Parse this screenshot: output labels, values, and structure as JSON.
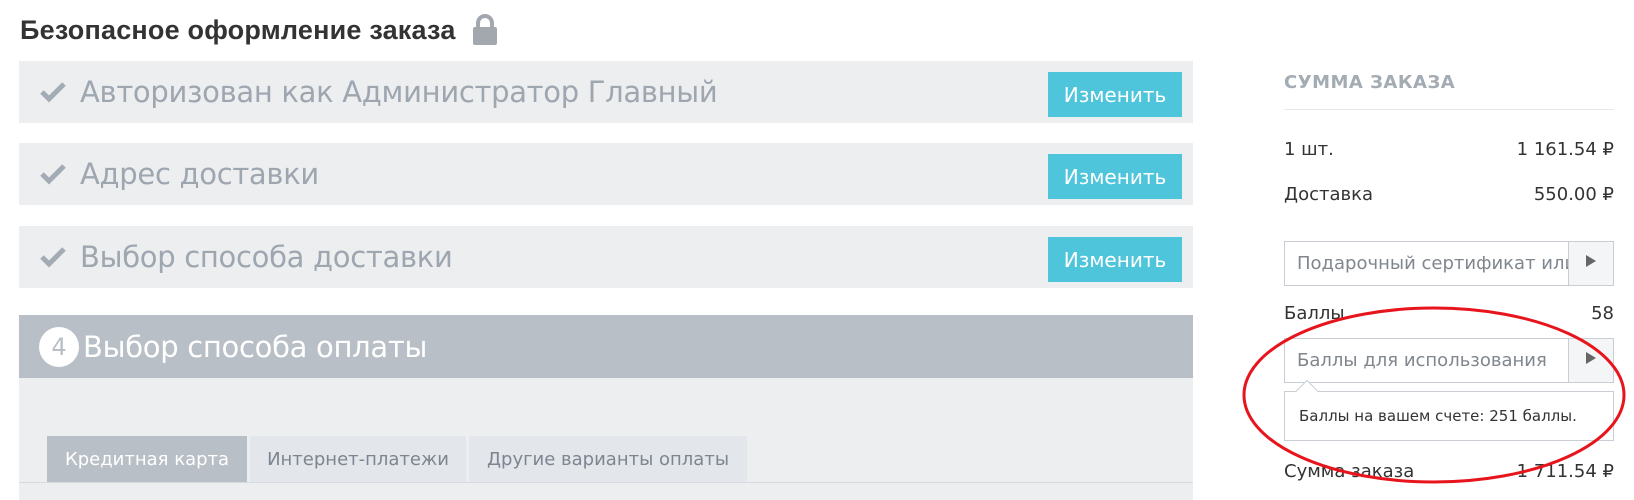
{
  "page": {
    "title": "Безопасное оформление заказа",
    "lock_icon": "lock-icon"
  },
  "steps": [
    {
      "title": "Авторизован как Администратор Главный",
      "edit_label": "Изменить",
      "done": true
    },
    {
      "title": "Адрес доставки",
      "edit_label": "Изменить",
      "done": true
    },
    {
      "title": "Выбор способа доставки",
      "edit_label": "Изменить",
      "done": true
    }
  ],
  "active_step": {
    "number": "4",
    "title": "Выбор способа оплаты"
  },
  "payment_tabs": [
    {
      "label": "Кредитная карта",
      "active": true
    },
    {
      "label": "Интернет-платежи",
      "active": false
    },
    {
      "label": "Другие варианты оплаты",
      "active": false
    }
  ],
  "summary": {
    "title": "СУММА ЗАКАЗА",
    "items_label": "1 шт.",
    "items_value": "1 161.54 ₽",
    "delivery_label": "Доставка",
    "delivery_value": "550.00 ₽",
    "gift_placeholder": "Подарочный сертификат или г",
    "points_label": "Баллы",
    "points_value": "58",
    "points_placeholder": "Баллы для использования",
    "points_tooltip": "Баллы на вашем счете: 251 баллы.",
    "total_label": "Сумма заказа",
    "total_value": "1 711.54 ₽"
  },
  "colors": {
    "accent": "#4ec5da",
    "step_bg": "#edeef0",
    "active_step_bg": "#b9bfc6",
    "highlight": "#e8141c"
  }
}
